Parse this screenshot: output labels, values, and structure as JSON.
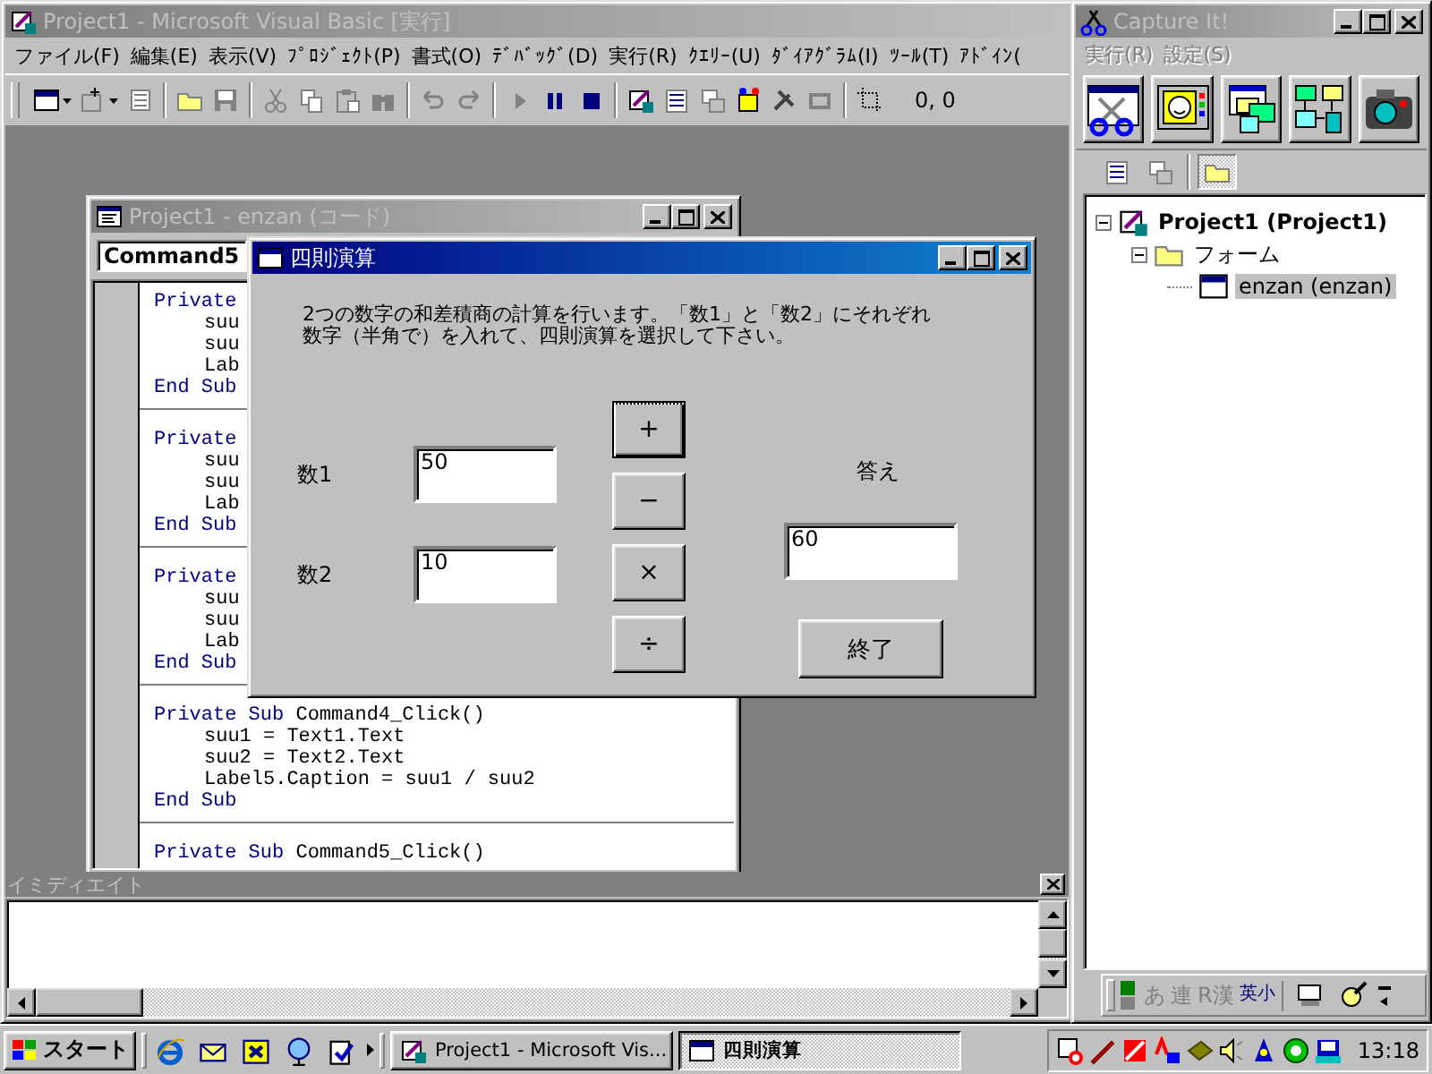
{
  "vb_window": {
    "title": "Project1 - Microsoft Visual Basic [実行]",
    "active": false,
    "menu": [
      "ファイル(F)",
      "編集(E)",
      "表示(V)",
      "ﾌﾟﾛｼﾞｪｸﾄ(P)",
      "書式(O)",
      "ﾃﾞﾊﾞｯｸﾞ(D)",
      "実行(R)",
      "ｸｴﾘｰ(U)",
      "ﾀﾞｲｱｸﾞﾗﾑ(I)",
      "ﾂｰﾙ(T)",
      "ｱﾄﾞｲﾝ("
    ],
    "position": "0, 0"
  },
  "code_window": {
    "title": "Project1 - enzan (コード)",
    "active": false,
    "object_combo": "Command5",
    "procedures": [
      {
        "header": [
          {
            "text": "Private",
            "keyword": true
          }
        ],
        "body": [
          "suu",
          "suu",
          "Lab"
        ],
        "footer": "End Sub"
      },
      {
        "header": [
          {
            "text": "Private",
            "keyword": true
          }
        ],
        "body": [
          "suu",
          "suu",
          "Lab"
        ],
        "footer": "End Sub"
      },
      {
        "header": [
          {
            "text": "Private",
            "keyword": true
          }
        ],
        "body": [
          "suu",
          "suu",
          "Lab"
        ],
        "footer": "End Sub"
      },
      {
        "header": [
          {
            "text": "Private Sub",
            "keyword": true
          },
          {
            "text": " Command4_Click()",
            "keyword": false
          }
        ],
        "body": [
          "suu1 = Text1.Text",
          "suu2 = Text2.Text",
          "Label5.Caption = suu1 / suu2"
        ],
        "footer": "End Sub"
      },
      {
        "header": [
          {
            "text": "Private Sub",
            "keyword": true
          },
          {
            "text": " Command5_Click()",
            "keyword": false
          }
        ]
      }
    ]
  },
  "dialog": {
    "title": "四則演算",
    "active": true,
    "description": [
      "2つの数字の和差積商の計算を行います。「数1」と「数2」にそれぞれ",
      "数字（半角で）を入れて、四則演算を選択して下さい。"
    ],
    "inputs": [
      {
        "label": "数1",
        "value": "50"
      },
      {
        "label": "数2",
        "value": "10"
      }
    ],
    "operators": [
      {
        "label": "+",
        "focused": true
      },
      {
        "label": "−",
        "focused": false
      },
      {
        "label": "×",
        "focused": false
      },
      {
        "label": "÷",
        "focused": false
      }
    ],
    "answer": {
      "label": "答え",
      "value": "60"
    },
    "close_button": "終了"
  },
  "immediate": {
    "title": "イミディエイト"
  },
  "capture": {
    "title": "Capture It!",
    "active": false,
    "menu": [
      {
        "label": "実行(R)",
        "disabled": true
      },
      {
        "label": "設定(S)",
        "disabled": true
      }
    ]
  },
  "project_explorer": {
    "toolbar": [
      {
        "selected": false
      },
      {
        "selected": false
      },
      {
        "selected": true
      }
    ],
    "tree": [
      {
        "label": "Project1 (Project1)",
        "kind": "project",
        "expanded": true,
        "selected": false,
        "children": [
          {
            "label": "フォーム",
            "kind": "folder",
            "expanded": true,
            "selected": false,
            "children": [
              {
                "label": "enzan (enzan)",
                "kind": "form",
                "selected": true
              }
            ]
          }
        ]
      }
    ]
  },
  "ime_bar": [
    {
      "label": "あ",
      "disabled": true
    },
    {
      "label": "連",
      "disabled": true
    },
    {
      "label": "R漢",
      "disabled": true
    },
    {
      "label": "英小",
      "disabled": false
    }
  ],
  "taskbar": {
    "start": "スタート",
    "tasks": [
      {
        "label": "Project1 - Microsoft Vis...",
        "selected": false
      },
      {
        "label": "四則演算",
        "selected": true
      }
    ],
    "clock": "13:18"
  }
}
